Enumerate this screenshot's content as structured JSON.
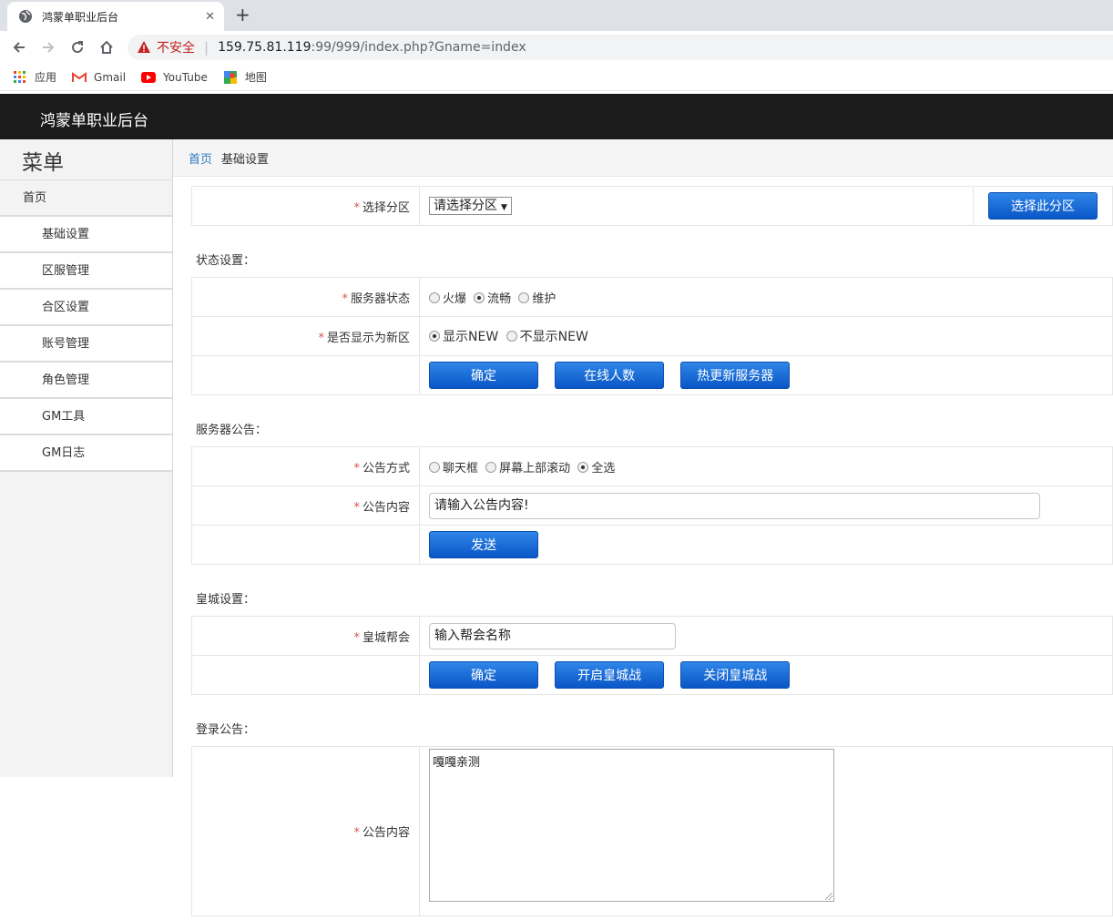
{
  "browser": {
    "tab_title": "鸿蒙单职业后台",
    "tab_close": "✕",
    "new_tab": "+",
    "security_label": "不安全",
    "url_host": "159.75.81.119",
    "url_path": ":99/999/index.php?Gname=index",
    "bookmarks": [
      {
        "label": "应用",
        "icon": "apps-grid-icon"
      },
      {
        "label": "Gmail",
        "icon": "gmail-icon"
      },
      {
        "label": "YouTube",
        "icon": "youtube-icon"
      },
      {
        "label": "地图",
        "icon": "maps-icon"
      }
    ]
  },
  "app": {
    "title": "鸿蒙单职业后台"
  },
  "sidebar": {
    "title": "菜单",
    "home": "首页",
    "items": [
      "基础设置",
      "区服管理",
      "合区设置",
      "账号管理",
      "角色管理",
      "GM工具",
      "GM日志"
    ]
  },
  "breadcrumb": {
    "home": "首页",
    "current": "基础设置"
  },
  "zone": {
    "label": "选择分区",
    "select_value": "请选择分区",
    "button": "选择此分区"
  },
  "status_section": {
    "title": "状态设置：",
    "server_status_label": "服务器状态",
    "server_status_options": [
      {
        "label": "火爆",
        "checked": false
      },
      {
        "label": "流畅",
        "checked": true
      },
      {
        "label": "维护",
        "checked": false
      }
    ],
    "new_zone_label": "是否显示为新区",
    "new_zone_options": [
      {
        "label": "显示NEW",
        "checked": true
      },
      {
        "label": "不显示NEW",
        "checked": false
      }
    ],
    "buttons": [
      "确定",
      "在线人数",
      "热更新服务器"
    ]
  },
  "notice_section": {
    "title": "服务器公告：",
    "mode_label": "公告方式",
    "mode_options": [
      {
        "label": "聊天框",
        "checked": false
      },
      {
        "label": "屏幕上部滚动",
        "checked": false
      },
      {
        "label": "全选",
        "checked": true
      }
    ],
    "content_label": "公告内容",
    "content_placeholder": "请输入公告内容!",
    "send_button": "发送"
  },
  "castle_section": {
    "title": "皇城设置：",
    "guild_label": "皇城帮会",
    "guild_placeholder": "输入帮会名称",
    "buttons": [
      "确定",
      "开启皇城战",
      "关闭皇城战"
    ]
  },
  "login_section": {
    "title": "登录公告：",
    "content_label": "公告内容",
    "content_value": "嘎嘎亲测"
  },
  "colors": {
    "header_bg": "#1b1b1b",
    "button_blue": "#0a56c7",
    "link_blue": "#2d7bc4",
    "required_red": "#d9534f"
  }
}
